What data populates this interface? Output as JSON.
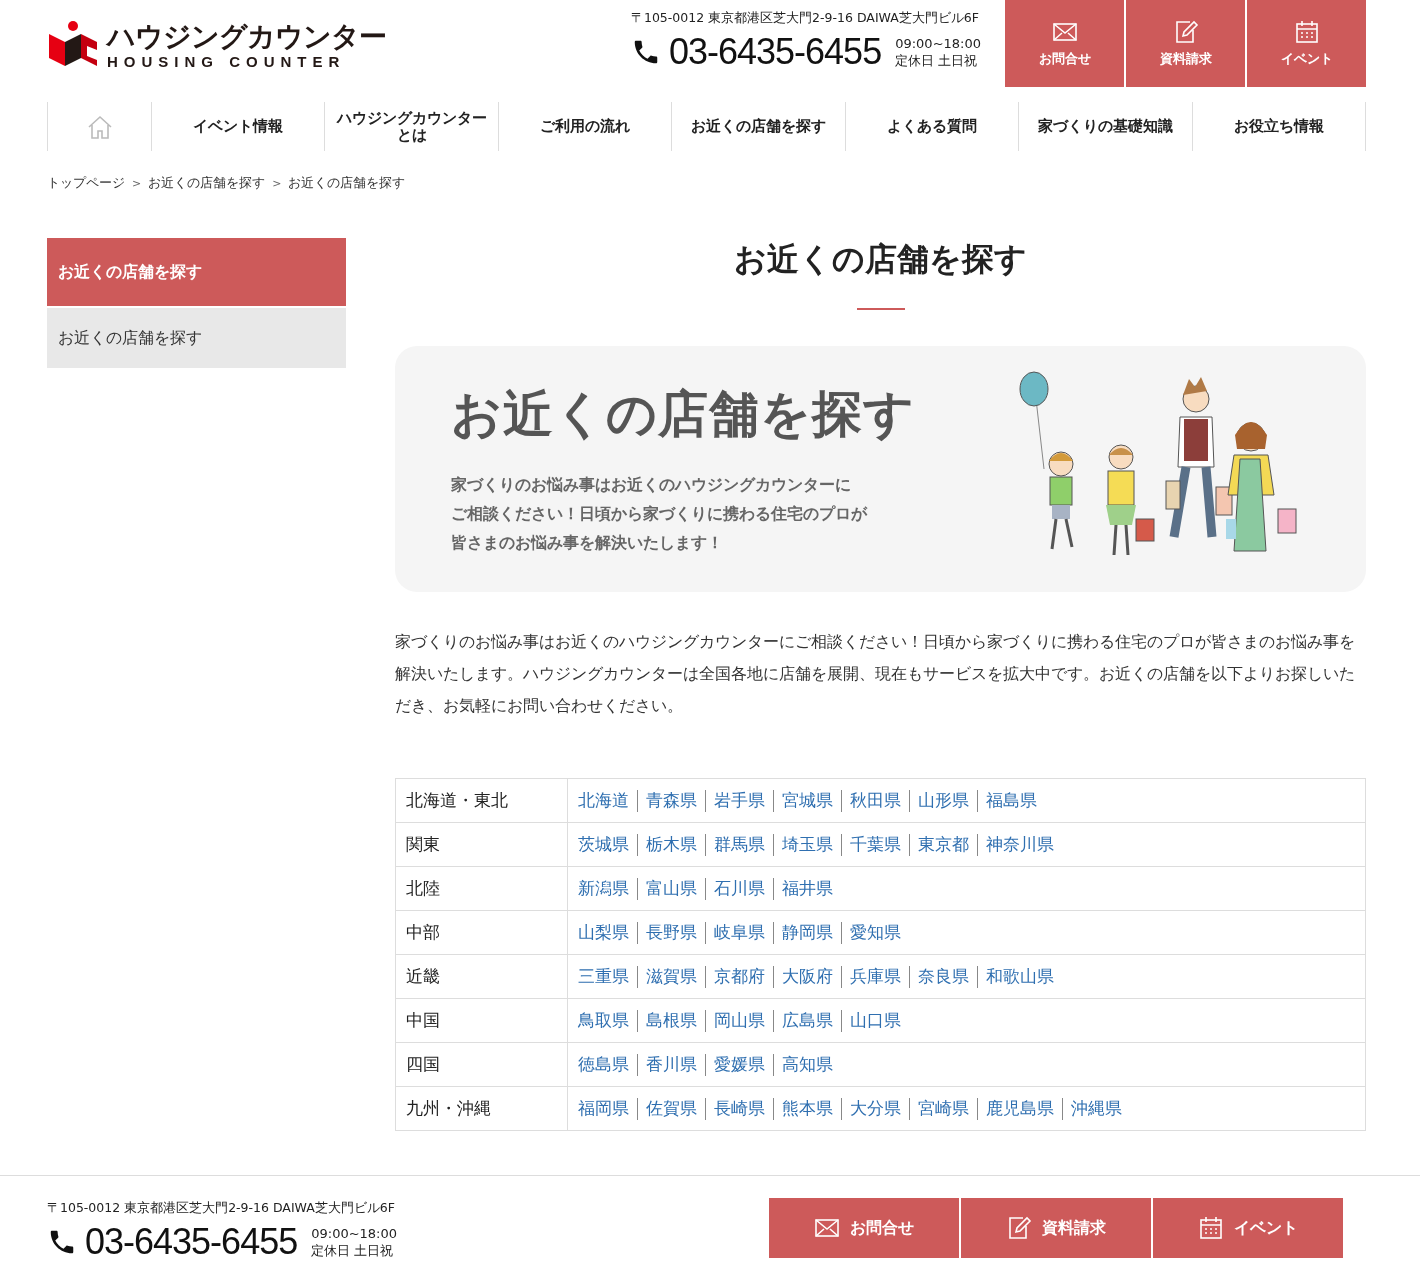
{
  "header": {
    "logo": {
      "name": "ハウジングカウンター",
      "sub": "HOUSING COUNTER"
    },
    "address": "〒105-0012 東京都港区芝大門2-9-16 DAIWA芝大門ビル6F",
    "phone": "03-6435-6455",
    "hours": "09:00~18:00",
    "closed": "定休日 土日祝",
    "actions": [
      "お問合せ",
      "資料請求",
      "イベント"
    ]
  },
  "nav": [
    {
      "label": "イベント情報",
      "selected": false
    },
    {
      "label": "ハウジングカウンターとは",
      "selected": false
    },
    {
      "label": "ご利用の流れ",
      "selected": false
    },
    {
      "label": "お近くの店舗を探す",
      "selected": false
    },
    {
      "label": "よくある質問",
      "selected": false
    },
    {
      "label": "家づくりの基礎知識",
      "selected": false
    },
    {
      "label": "お役立ち情報",
      "selected": false
    }
  ],
  "breadcrumb": [
    {
      "kind": "link",
      "text": "トップページ"
    },
    {
      "kind": "separator",
      "text": ">"
    },
    {
      "kind": "link",
      "text": "お近くの店舗を探す"
    },
    {
      "kind": "separator",
      "text": ">"
    },
    {
      "kind": "link",
      "text": "お近くの店舗を探す"
    }
  ],
  "sidebar": {
    "heading": "お近くの店舗を探す",
    "items": [
      {
        "label": "お近くの店舗を探す",
        "selected": false
      }
    ]
  },
  "page_title": "お近くの店舗を探す",
  "banner": {
    "title": "お近くの店舗を探す",
    "lines": [
      "家づくりのお悩み事はお近くのハウジングカウンターに",
      "ご相談ください！日頃から家づくりに携わる住宅のプロが",
      "皆さまのお悩み事を解決いたします！"
    ]
  },
  "intro": "家づくりのお悩み事はお近くのハウジングカウンターにご相談ください！日頃から家づくりに携わる住宅のプロが皆さまのお悩み事を解決いたします。ハウジングカウンターは全国各地に店舗を展開、現在もサービスを拡大中です。お近くの店舗を以下よりお探しいただき、お気軽にお問い合わせください。",
  "regions": [
    {
      "name": "北海道・東北",
      "prefectures": [
        "北海道",
        "青森県",
        "岩手県",
        "宮城県",
        "秋田県",
        "山形県",
        "福島県"
      ]
    },
    {
      "name": "関東",
      "prefectures": [
        "茨城県",
        "栃木県",
        "群馬県",
        "埼玉県",
        "千葉県",
        "東京都",
        "神奈川県"
      ]
    },
    {
      "name": "北陸",
      "prefectures": [
        "新潟県",
        "富山県",
        "石川県",
        "福井県"
      ]
    },
    {
      "name": "中部",
      "prefectures": [
        "山梨県",
        "長野県",
        "岐阜県",
        "静岡県",
        "愛知県"
      ]
    },
    {
      "name": "近畿",
      "prefectures": [
        "三重県",
        "滋賀県",
        "京都府",
        "大阪府",
        "兵庫県",
        "奈良県",
        "和歌山県"
      ]
    },
    {
      "name": "中国",
      "prefectures": [
        "鳥取県",
        "島根県",
        "岡山県",
        "広島県",
        "山口県"
      ]
    },
    {
      "name": "四国",
      "prefectures": [
        "徳島県",
        "香川県",
        "愛媛県",
        "高知県"
      ]
    },
    {
      "name": "九州・沖縄",
      "prefectures": [
        "福岡県",
        "佐賀県",
        "長崎県",
        "熊本県",
        "大分県",
        "宮崎県",
        "鹿児島県",
        "沖縄県"
      ]
    }
  ],
  "footer": {
    "address": "〒105-0012 東京都港区芝大門2-9-16 DAIWA芝大門ビル6F",
    "phone": "03-6435-6455",
    "hours": "09:00~18:00",
    "closed": "定休日 土日祝",
    "actions": [
      "お問合せ",
      "資料請求",
      "イベント"
    ]
  }
}
